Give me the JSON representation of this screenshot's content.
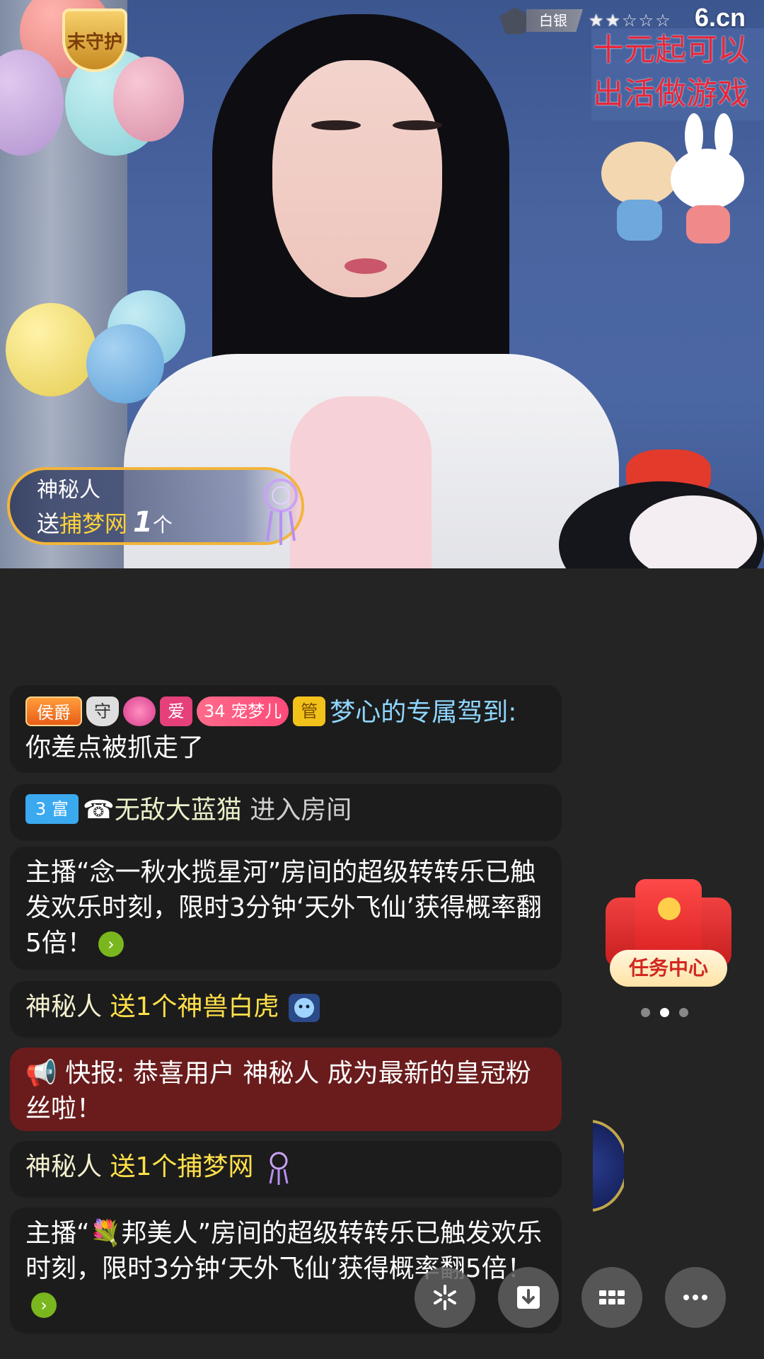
{
  "video": {
    "guard_badge": "末守护",
    "rank_label": "白银",
    "rank_stars": 2,
    "rank_stars_total": 5,
    "site_logo": "6.cn",
    "promo_line1": "十元起可以",
    "promo_line2": "出活做游戏"
  },
  "gift_banner": {
    "sender": "神秘人",
    "action": "送",
    "gift": "捕梦网",
    "count": "1",
    "unit": "个"
  },
  "chat": {
    "msg1": {
      "badges": [
        "侯爵",
        "守",
        "",
        "爱",
        "34",
        "宠梦儿",
        "管"
      ],
      "user": "梦心的专属驾到:",
      "text": "你差点被抓走了"
    },
    "msg2": {
      "badge_num": "3",
      "badge_label": "富",
      "user": "无敌大蓝猫",
      "action": "进入房间"
    },
    "msg3": {
      "text": "主播“念一秋水揽星河”房间的超级转转乐已触发欢乐时刻，限时3分钟‘天外飞仙’获得概率翻5倍！"
    },
    "msg4": {
      "user": "神秘人",
      "text": "送1个神兽白虎"
    },
    "msg5": {
      "text": "快报: 恭喜用户 神秘人 成为最新的皇冠粉丝啦！"
    },
    "msg6": {
      "user": "神秘人",
      "text": "送1个捕梦网"
    },
    "msg7": {
      "text": "主播“💐邦美人”房间的超级转转乐已触发欢乐时刻，限时3分钟‘天外飞仙’获得概率翻5倍！"
    }
  },
  "task_center": {
    "label": "任务中心"
  },
  "colors": {
    "chat_bg": "#1c1c1c",
    "alert_bg": "#6a1c1c",
    "highlight_yellow": "#ffe04a",
    "username_blue": "#8fd6ff"
  }
}
